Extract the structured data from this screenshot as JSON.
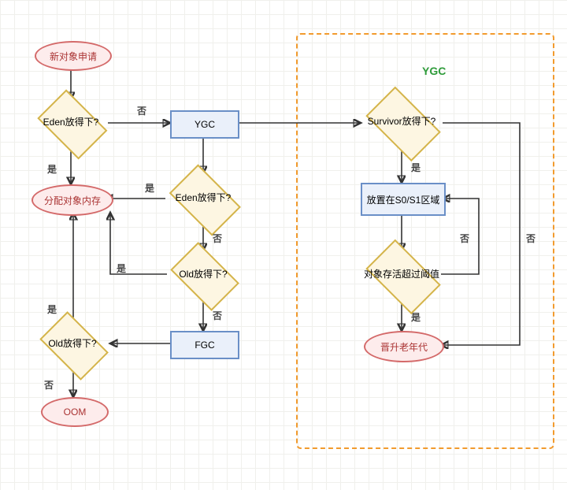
{
  "title": "YGC",
  "nodes": {
    "new_obj": "新对象申请",
    "eden1": "Eden放得下?",
    "ygc": "YGC",
    "alloc": "分配对象内存",
    "eden2": "Eden放得下?",
    "old_fit_mid": "Old放得下?",
    "old_fit_left": "Old放得下?",
    "fgc": "FGC",
    "oom": "OOM",
    "survivor": "Survivor放得下?",
    "s0s1": "放置在S0/S1区域",
    "threshold": "对象存活超过阈值",
    "promote": "晋升老年代"
  },
  "labels": {
    "yes": "是",
    "no": "否"
  }
}
